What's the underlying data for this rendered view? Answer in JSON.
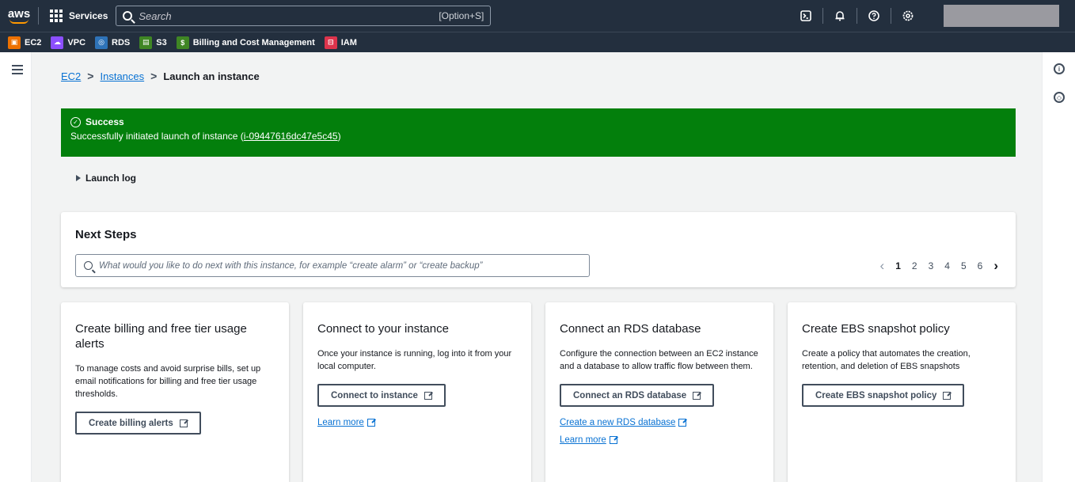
{
  "topnav": {
    "logo": "aws",
    "services_label": "Services",
    "search_placeholder": "Search",
    "search_shortcut": "[Option+S]",
    "icons": [
      "cloudshell-icon",
      "bell-icon",
      "help-icon",
      "settings-icon"
    ]
  },
  "favorites": [
    {
      "label": "EC2",
      "color": "#ed7100"
    },
    {
      "label": "VPC",
      "color": "#8c4fff"
    },
    {
      "label": "RDS",
      "color": "#2e73b8"
    },
    {
      "label": "S3",
      "color": "#3f8624"
    },
    {
      "label": "Billing and Cost Management",
      "color": "#3f8624"
    },
    {
      "label": "IAM",
      "color": "#dd344c"
    }
  ],
  "breadcrumb": {
    "item1": "EC2",
    "item2": "Instances",
    "current": "Launch an instance"
  },
  "flash": {
    "title": "Success",
    "message_prefix": "Successfully initiated launch of instance (",
    "instance_id": "i-09447616dc47e5c45",
    "message_suffix": ")",
    "color": "#037f0c"
  },
  "launch_log": "Launch log",
  "next_steps": {
    "title": "Next Steps",
    "search_placeholder": "What would you like to do next with this instance, for example “create alarm” or “create backup”",
    "pages": [
      "1",
      "2",
      "3",
      "4",
      "5",
      "6"
    ],
    "current_page": "1"
  },
  "cards": [
    {
      "title": "Create billing and free tier usage alerts",
      "description": "To manage costs and avoid surprise bills, set up email notifications for billing and free tier usage thresholds.",
      "button": "Create billing alerts"
    },
    {
      "title": "Connect to your instance",
      "description": "Once your instance is running, log into it from your local computer.",
      "button": "Connect to instance",
      "link1": "Learn more"
    },
    {
      "title": "Connect an RDS database",
      "description": "Configure the connection between an EC2 instance and a database to allow traffic flow between them.",
      "button": "Connect an RDS database",
      "link1": "Create a new RDS database",
      "link2": "Learn more"
    },
    {
      "title": "Create EBS snapshot policy",
      "description": "Create a policy that automates the creation, retention, and deletion of EBS snapshots",
      "button": "Create EBS snapshot policy"
    }
  ]
}
